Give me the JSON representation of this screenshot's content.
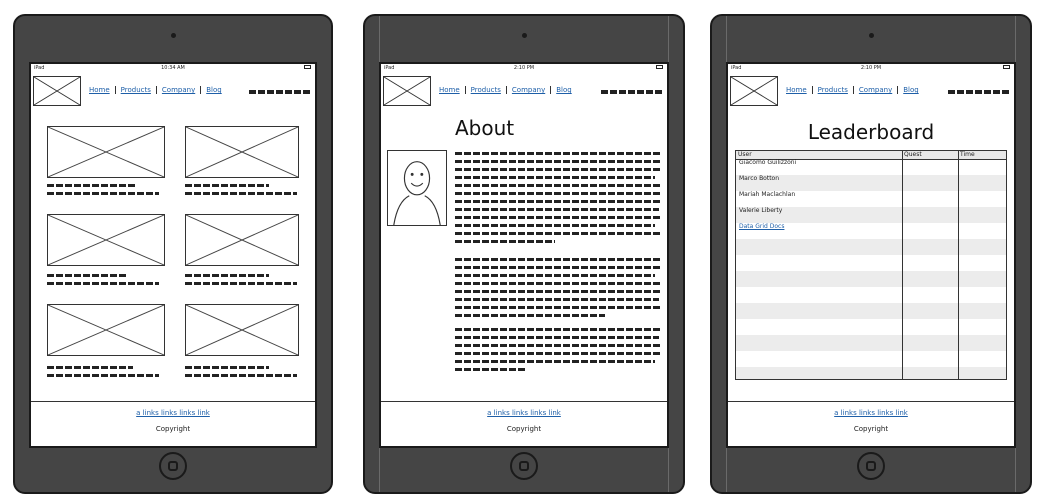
{
  "status_bar": {
    "device": "iPad",
    "times": [
      "10:34 AM",
      "2:10 PM",
      "2:10 PM"
    ]
  },
  "nav": {
    "items": [
      "Home",
      "Products",
      "Company",
      "Blog"
    ]
  },
  "footer": {
    "links": "a links links links link",
    "copyright": "Copyright"
  },
  "about": {
    "title": "About"
  },
  "leaderboard": {
    "title": "Leaderboard",
    "columns": [
      "User",
      "Quest",
      "Time"
    ],
    "rows": [
      "Giacomo Guilizzoni",
      "Marco Botton",
      "Mariah Maclachlan",
      "Valerie Liberty",
      "Data Grid Docs"
    ]
  },
  "colors": {
    "frame": "#454545",
    "link": "#1e5fa8",
    "grid_alt": "#ececec"
  }
}
